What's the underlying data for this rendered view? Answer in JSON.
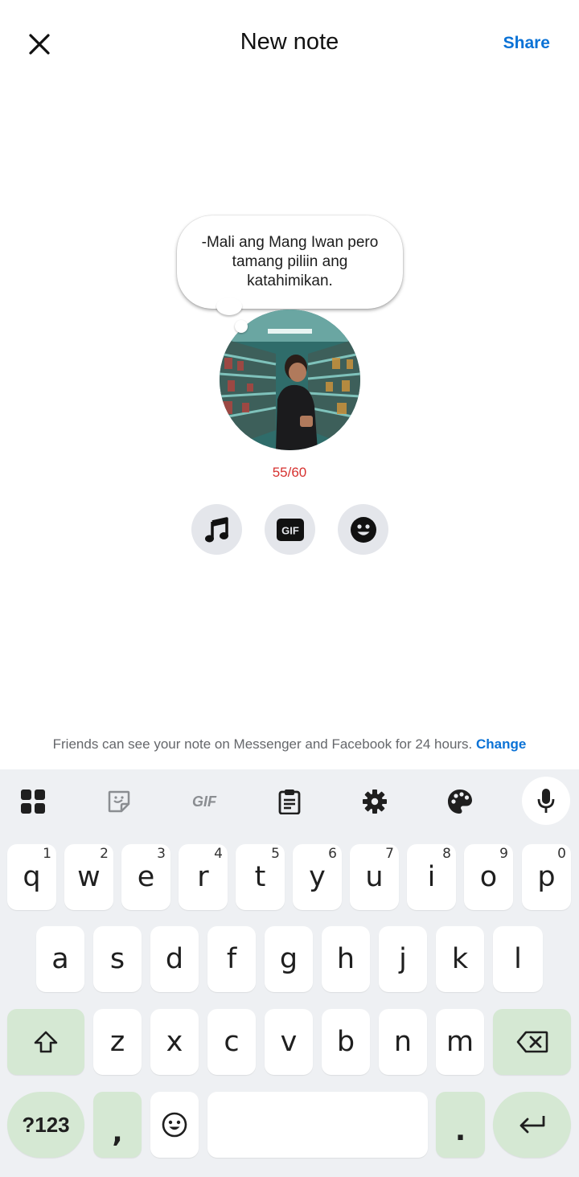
{
  "header": {
    "title": "New note",
    "share_label": "Share",
    "close_icon": "close-icon"
  },
  "note": {
    "text": "-Mali ang Mang Iwan pero tamang piliin ang katahimikan.",
    "char_count": "55/60"
  },
  "tools": [
    {
      "name": "music-icon"
    },
    {
      "name": "gif-icon"
    },
    {
      "name": "emoji-icon"
    }
  ],
  "notice": {
    "text": "Friends can see your note on Messenger and Facebook for 24 hours.",
    "change_label": "Change"
  },
  "keyboard": {
    "toolbar_icons": [
      "apps-grid-icon",
      "sticker-icon",
      "gif-icon",
      "clipboard-icon",
      "settings-icon",
      "palette-icon",
      "mic-icon"
    ],
    "toolbar_gif_label": "GIF",
    "row1": [
      {
        "key": "q",
        "hint": "1"
      },
      {
        "key": "w",
        "hint": "2"
      },
      {
        "key": "e",
        "hint": "3"
      },
      {
        "key": "r",
        "hint": "4"
      },
      {
        "key": "t",
        "hint": "5"
      },
      {
        "key": "y",
        "hint": "6"
      },
      {
        "key": "u",
        "hint": "7"
      },
      {
        "key": "i",
        "hint": "8"
      },
      {
        "key": "o",
        "hint": "9"
      },
      {
        "key": "p",
        "hint": "0"
      }
    ],
    "row2": [
      "a",
      "s",
      "d",
      "f",
      "g",
      "h",
      "j",
      "k",
      "l"
    ],
    "row3": [
      "z",
      "x",
      "c",
      "v",
      "b",
      "n",
      "m"
    ],
    "symbols_label": "?123",
    "comma_label": ",",
    "period_label": ".",
    "accent_color": "#d5e8d3"
  },
  "colors": {
    "link": "#0a72d6",
    "counter": "#d6312f"
  }
}
